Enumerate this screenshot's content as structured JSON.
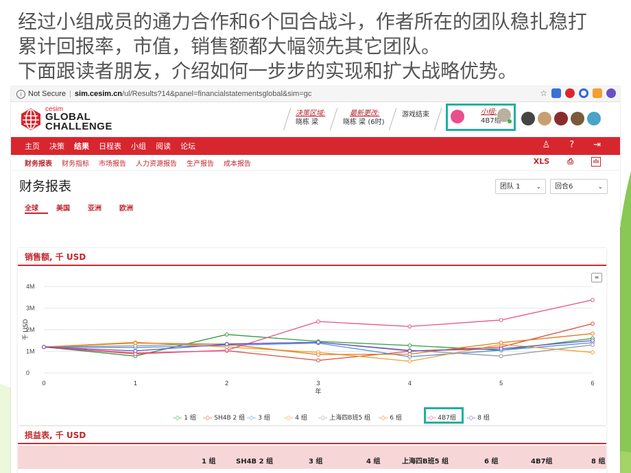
{
  "slide": {
    "line1": "经过小组成员的通力合作和6个回合战斗，作者所在的团队稳扎稳打",
    "line2": "累计回报率，市值，销售额都大幅领先其它团队。",
    "line3": "下面跟读者朋友，介绍如何一步步的实现和扩大战略优势。"
  },
  "browser": {
    "security": "Not Secure",
    "host": "sim.cesim.cn",
    "path": "/ul/Results?14&panel=financialstatementsglobal&sim=gc"
  },
  "header": {
    "brand_small": "cesim",
    "brand_line1": "GLOBAL",
    "brand_line2": "CHALLENGE",
    "decision_label": "决策区域:",
    "decision_value": "晓栋 梁",
    "update_label": "最新更改:",
    "update_value": "晓栋 梁 (6时)",
    "game_status": "游戏结束",
    "team_label": "小组:",
    "team_value": "4B7组"
  },
  "nav": {
    "main": [
      "主页",
      "决策",
      "结果",
      "日程表",
      "小组",
      "阅读",
      "论坛"
    ],
    "active_main": "结果",
    "sub": [
      "财务报表",
      "财务指标",
      "市场报告",
      "人力资源报告",
      "生产报告",
      "成本报告"
    ],
    "active_sub": "财务报表",
    "xls": "XLS"
  },
  "page": {
    "title": "财务报表",
    "team_select": "团队 1",
    "round_select": "回合6",
    "regions": [
      "全球",
      "美国",
      "亚洲",
      "欧洲"
    ]
  },
  "chart_card_title": "销售额, 千 USD",
  "chart_data": {
    "type": "line",
    "title": "销售额, 千 USD",
    "xlabel": "年",
    "ylabel": "千 USD",
    "x": [
      0,
      1,
      2,
      3,
      4,
      5,
      6
    ],
    "y_ticks": [
      "0",
      "1M",
      "2M",
      "3M",
      "4M"
    ],
    "ylim": [
      0,
      4000
    ],
    "grid": true,
    "legend": "bottom",
    "series": [
      {
        "name": "1 组",
        "color": "#2e9e3c",
        "values": [
          1200,
          780,
          1780,
          1460,
          1270,
          1050,
          1600
        ]
      },
      {
        "name": "SH4B 2 组",
        "color": "#e04a3a",
        "values": [
          1200,
          920,
          1030,
          580,
          1000,
          1200,
          2280
        ]
      },
      {
        "name": "3 组",
        "color": "#4a90e2",
        "values": [
          1200,
          1180,
          1280,
          1380,
          750,
          1050,
          1400
        ]
      },
      {
        "name": "4 组",
        "color": "#f0a030",
        "values": [
          1200,
          1420,
          1200,
          950,
          540,
          1320,
          950
        ]
      },
      {
        "name": "上海四B班5 组",
        "color": "#9a9a9a",
        "values": [
          1200,
          1260,
          1350,
          1420,
          1050,
          780,
          1300
        ]
      },
      {
        "name": "6 组",
        "color": "#e07a20",
        "values": [
          1200,
          1380,
          1330,
          850,
          870,
          1400,
          1820
        ]
      },
      {
        "name": "4B7组",
        "color": "#e8508c",
        "values": [
          1200,
          880,
          1050,
          2380,
          2150,
          2450,
          3380
        ]
      },
      {
        "name": "8 组",
        "color": "#6a4fc8",
        "values": [
          1200,
          1020,
          1330,
          1420,
          1020,
          1120,
          1500
        ]
      }
    ]
  },
  "table_card_title": "损益表, 千 USD",
  "table_headers": [
    "1 组",
    "SH4B 2 组",
    "3 组",
    "4 组",
    "上海四B班5 组",
    "6 组",
    "4B7组",
    "8 组"
  ]
}
